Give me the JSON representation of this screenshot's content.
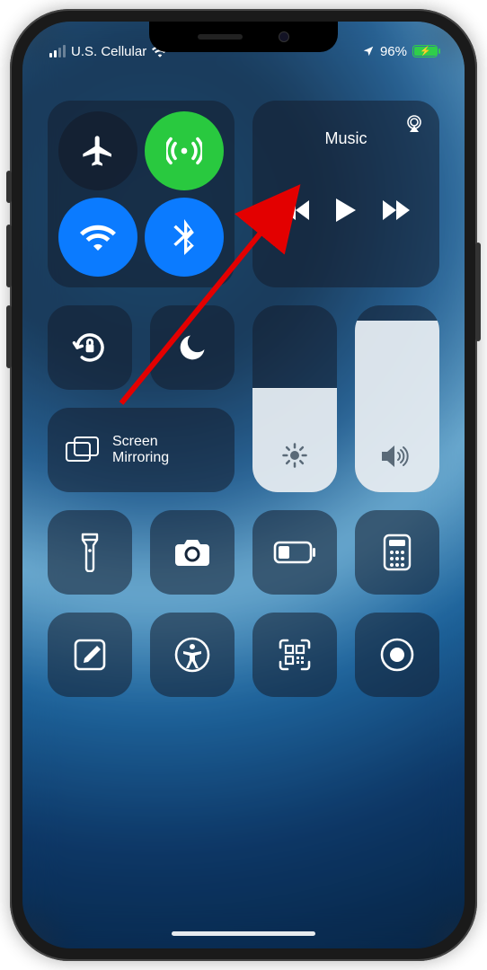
{
  "status": {
    "carrier": "U.S. Cellular",
    "battery_percent": "96%"
  },
  "connectivity": {
    "airplane": "airplane-icon",
    "cellular": "cellular-icon",
    "wifi": "wifi-icon",
    "bluetooth": "bluetooth-icon"
  },
  "music": {
    "title": "Music"
  },
  "screen_mirroring": {
    "line1": "Screen",
    "line2": "Mirroring"
  },
  "sliders": {
    "brightness_percent": 56,
    "volume_percent": 92
  },
  "tiles": {
    "flashlight": "flashlight-icon",
    "camera": "camera-icon",
    "low_power": "low-power-icon",
    "calculator": "calculator-icon",
    "notes": "notes-icon",
    "accessibility": "accessibility-icon",
    "qr": "qr-scanner-icon",
    "screen_record": "screen-record-icon"
  }
}
